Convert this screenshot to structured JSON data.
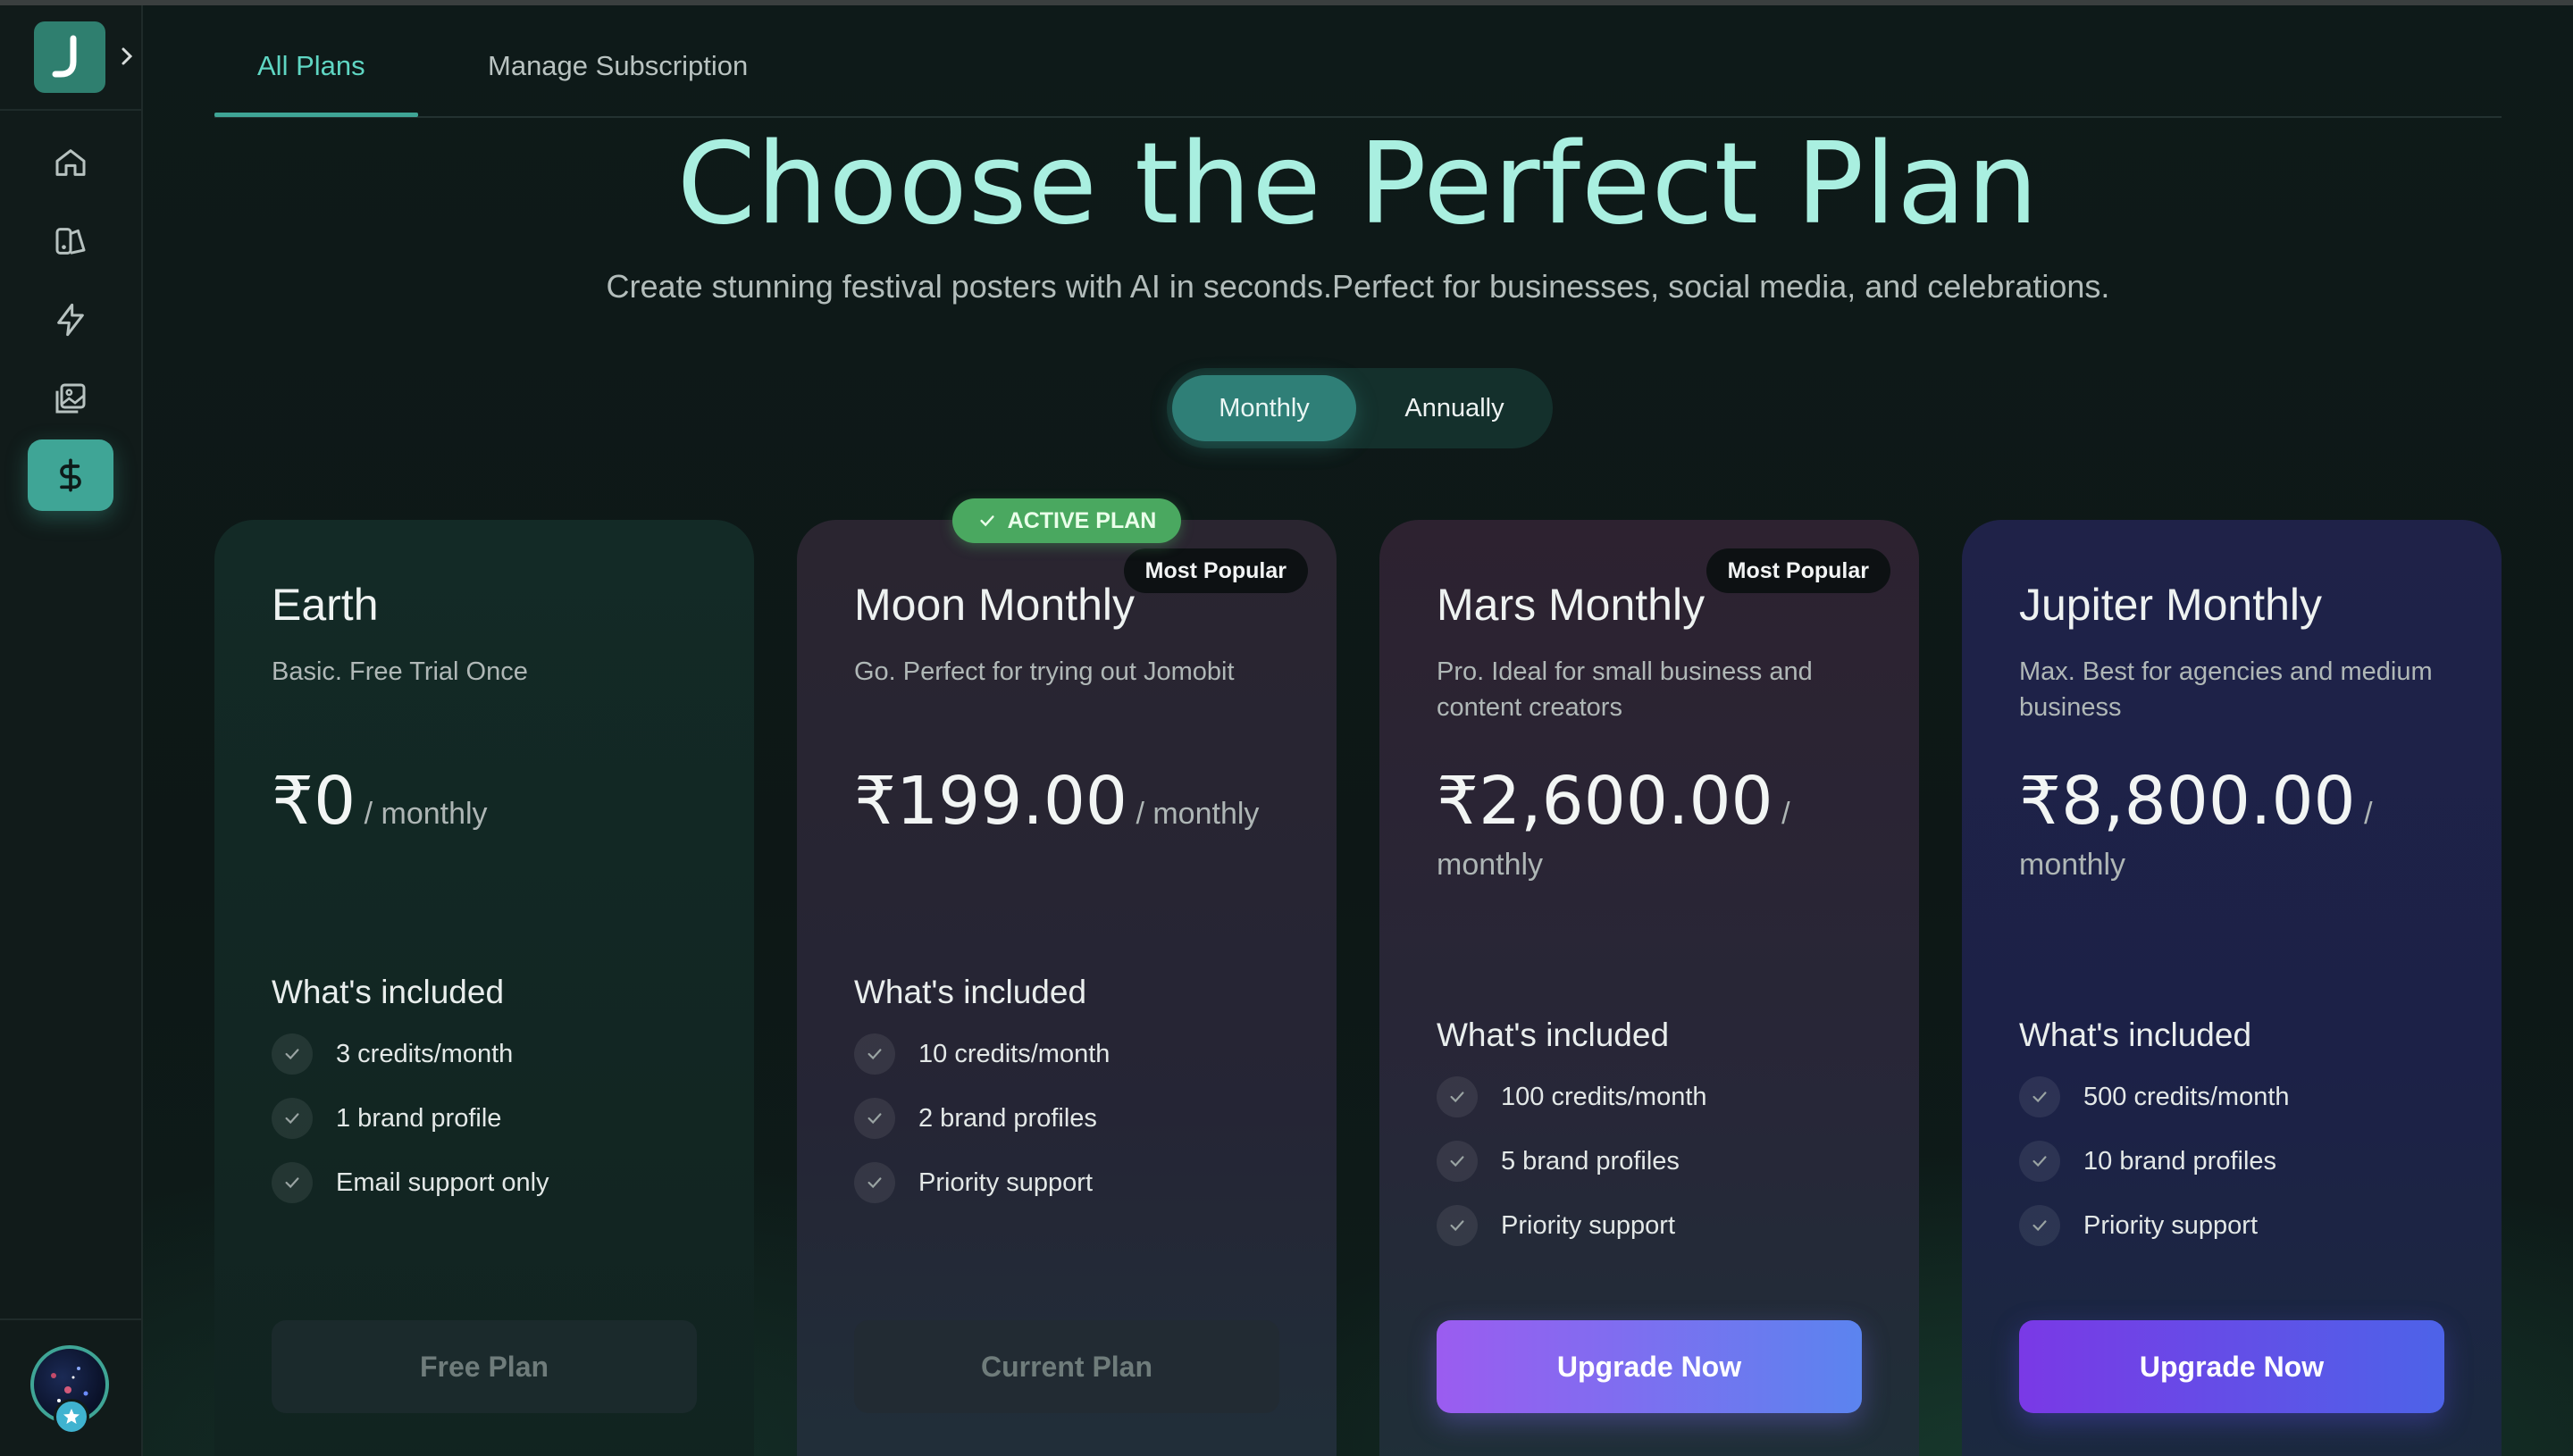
{
  "tabs": [
    {
      "label": "All Plans",
      "active": true
    },
    {
      "label": "Manage Subscription",
      "active": false
    }
  ],
  "hero": {
    "title": "Choose the Perfect Plan",
    "subtitle": "Create stunning festival posters with AI in seconds.Perfect for businesses, social media, and celebrations."
  },
  "billing_toggle": {
    "monthly": "Monthly",
    "annually": "Annually",
    "selected": "Monthly"
  },
  "sidebar": {
    "items": [
      {
        "icon": "home-icon"
      },
      {
        "icon": "palette-icon"
      },
      {
        "icon": "lightning-icon"
      },
      {
        "icon": "gallery-icon"
      },
      {
        "icon": "dollar-icon",
        "active": true
      }
    ]
  },
  "included_title": "What's included",
  "plans": [
    {
      "name": "Earth",
      "description": "Basic. Free Trial Once",
      "price": "₹0",
      "period": " / monthly",
      "features": [
        "3 credits/month",
        "1 brand profile",
        "Email support only"
      ],
      "cta": "Free Plan"
    },
    {
      "name": "Moon Monthly",
      "description": "Go. Perfect for trying out Jomobit",
      "price": "₹199.00",
      "period": " / monthly",
      "badge": "Most Popular",
      "active_badge": "ACTIVE PLAN",
      "features": [
        "10 credits/month",
        "2 brand profiles",
        "Priority support"
      ],
      "cta": "Current Plan"
    },
    {
      "name": "Mars Monthly",
      "description": "Pro. Ideal for small business and content creators",
      "price": "₹2,600.00",
      "period": " / monthly",
      "badge": "Most Popular",
      "features": [
        "100 credits/month",
        "5 brand profiles",
        "Priority support"
      ],
      "cta": "Upgrade Now"
    },
    {
      "name": "Jupiter Monthly",
      "description": "Max. Best for agencies and medium business",
      "price": "₹8,800.00",
      "period": " / monthly",
      "features": [
        "500 credits/month",
        "10 brand profiles",
        "Priority support"
      ],
      "cta": "Upgrade Now"
    }
  ],
  "colors": {
    "accent": "#3fa596",
    "title": "#a9efe0",
    "active_badge": "#4aa860",
    "upgrade_gradient_start": "#9b5cf0",
    "upgrade_gradient_end": "#5b84ef"
  }
}
